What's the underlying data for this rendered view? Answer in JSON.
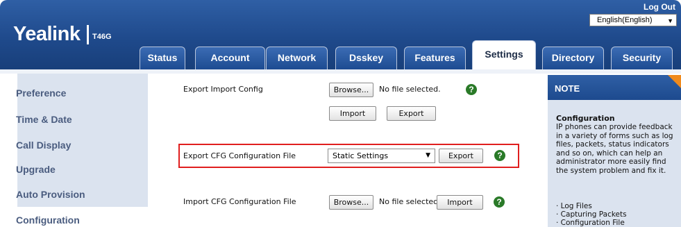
{
  "header": {
    "brand": "Yealink",
    "model": "T46G",
    "logout": "Log Out",
    "language": "English(English)"
  },
  "tabs": [
    {
      "label": "Status",
      "active": false
    },
    {
      "label": "Account",
      "active": false
    },
    {
      "label": "Network",
      "active": false
    },
    {
      "label": "Dsskey",
      "active": false
    },
    {
      "label": "Features",
      "active": false
    },
    {
      "label": "Settings",
      "active": true
    },
    {
      "label": "Directory",
      "active": false
    },
    {
      "label": "Security",
      "active": false
    }
  ],
  "sidebar": {
    "items": [
      {
        "label": "Preference"
      },
      {
        "label": "Time & Date"
      },
      {
        "label": "Call Display"
      },
      {
        "label": "Upgrade"
      },
      {
        "label": "Auto Provision"
      },
      {
        "label": "Configuration",
        "active": true
      }
    ]
  },
  "main": {
    "export_import_config": {
      "label": "Export Import Config",
      "browse": "Browse...",
      "file_status": "No file selected.",
      "import": "Import",
      "export": "Export"
    },
    "export_cfg": {
      "label": "Export CFG Configuration File",
      "selected": "Static Settings",
      "export": "Export"
    },
    "import_cfg": {
      "label": "Import CFG Configuration File",
      "browse": "Browse...",
      "file_status": "No file selectec",
      "import": "Import"
    }
  },
  "note": {
    "title": "NOTE",
    "heading": "Configuration",
    "body": "IP phones can provide feedback in a variety of forms such as log files, packets, status indicators and so on, which can help an administrator more easily find the system problem and fix it.",
    "items": [
      "· Log Files",
      "· Capturing Packets",
      "· Configuration File"
    ]
  },
  "colors": {
    "header": "#1f4a8c",
    "highlight": "#e01e1e",
    "help_icon": "#2a7a28",
    "note_corner": "#f08a1c"
  }
}
